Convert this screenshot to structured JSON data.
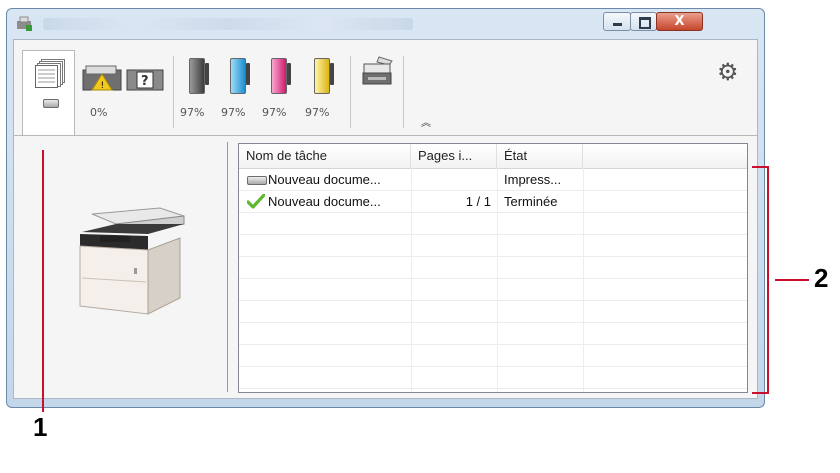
{
  "window": {
    "controls": {
      "close_glyph": "X"
    }
  },
  "toolbar": {
    "tabs": [
      {
        "name": "job-queue"
      },
      {
        "name": "paper",
        "value": "0%"
      },
      {
        "name": "toner-black",
        "value": "97%",
        "color": "#5a5a5a"
      },
      {
        "name": "toner-cyan",
        "value": "97%",
        "color": "#3aa9e0"
      },
      {
        "name": "toner-magenta",
        "value": "97%",
        "color": "#e2338a"
      },
      {
        "name": "toner-yellow",
        "value": "97%",
        "color": "#e8d43a"
      },
      {
        "name": "device-status"
      }
    ],
    "expand_glyph": "︽",
    "settings_glyph": "⚙"
  },
  "job_list": {
    "columns": [
      "Nom de tâche",
      "Pages i...",
      "État"
    ],
    "rows": [
      {
        "status_icon": "printing-icon",
        "name": "Nouveau docume...",
        "pages": "",
        "state": "Impress..."
      },
      {
        "status_icon": "check-icon",
        "name": "Nouveau docume...",
        "pages": "1 / 1",
        "state": "Terminée"
      }
    ]
  },
  "callouts": {
    "left": "1",
    "right": "2"
  },
  "colors": {
    "callout_line": "#c8102e",
    "check": "#5cb82e"
  }
}
